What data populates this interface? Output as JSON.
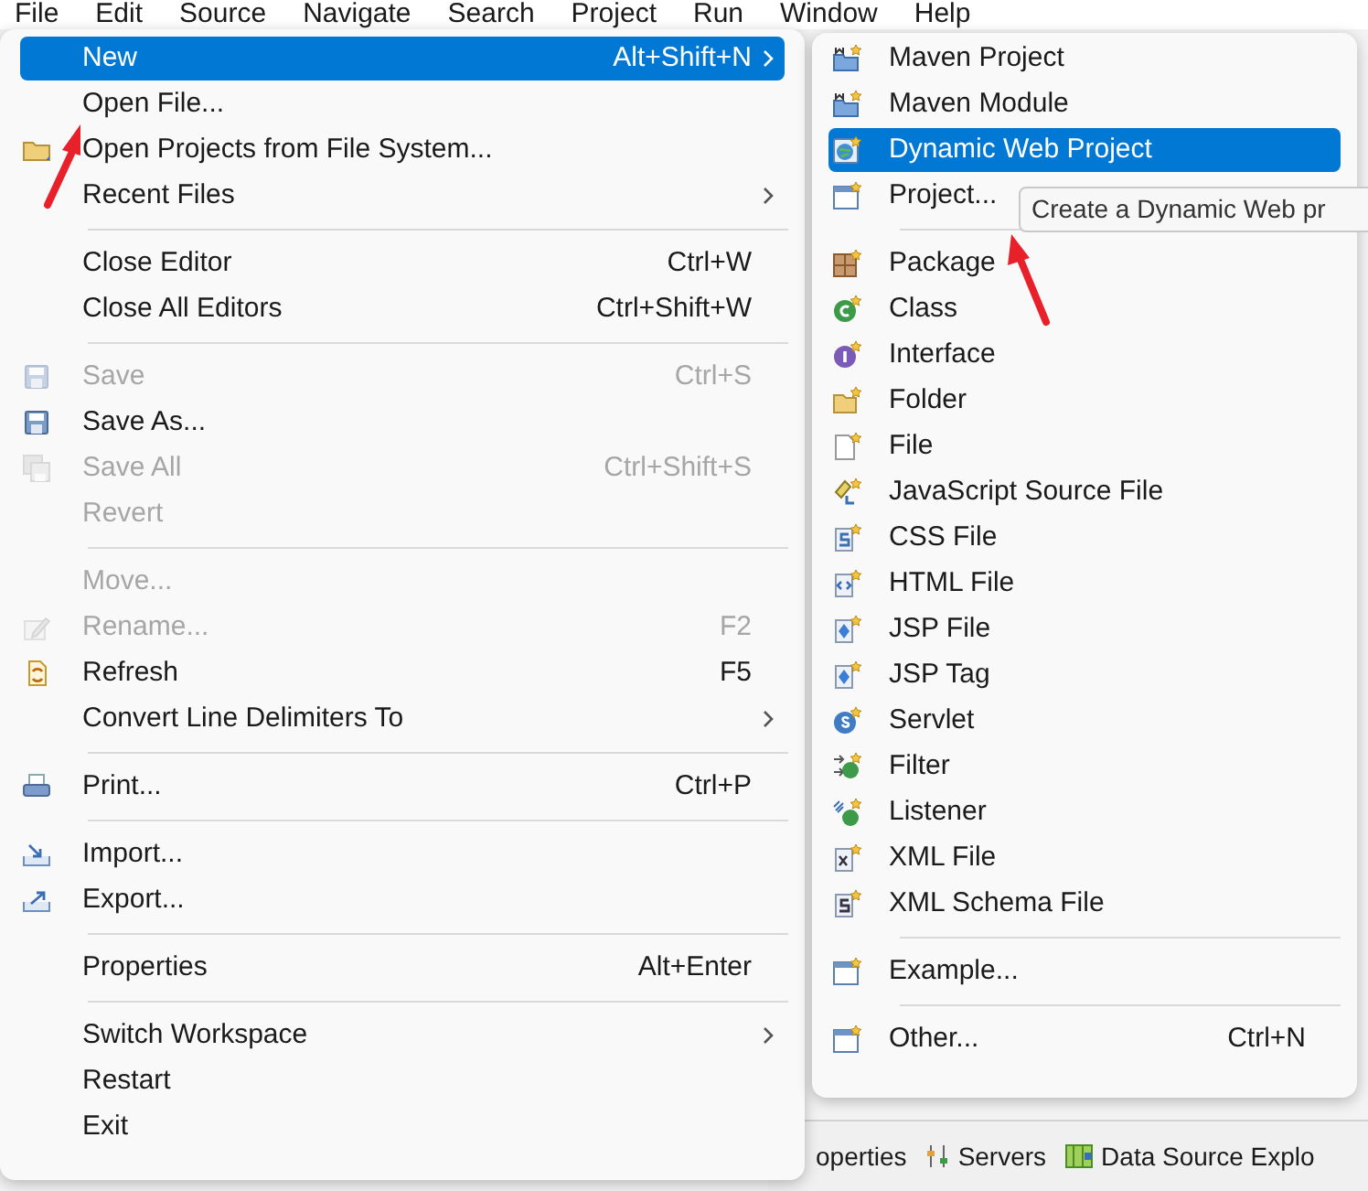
{
  "menubar": [
    "File",
    "Edit",
    "Source",
    "Navigate",
    "Search",
    "Project",
    "Run",
    "Window",
    "Help"
  ],
  "file_menu": {
    "items": [
      {
        "kind": "item",
        "label": "New",
        "shortcut": "Alt+Shift+N",
        "submenu": true,
        "disabled": false,
        "selected": true
      },
      {
        "kind": "item",
        "label": "Open File...",
        "disabled": false,
        "selected": false
      },
      {
        "kind": "item",
        "label": "Open Projects from File System...",
        "disabled": false,
        "selected": false
      },
      {
        "kind": "item",
        "label": "Recent Files",
        "submenu": true,
        "disabled": false,
        "selected": false
      },
      {
        "kind": "separator"
      },
      {
        "kind": "item",
        "label": "Close Editor",
        "shortcut": "Ctrl+W",
        "disabled": false,
        "selected": false
      },
      {
        "kind": "item",
        "label": "Close All Editors",
        "shortcut": "Ctrl+Shift+W",
        "disabled": false,
        "selected": false
      },
      {
        "kind": "separator"
      },
      {
        "kind": "item",
        "label": "Save",
        "shortcut": "Ctrl+S",
        "disabled": true,
        "selected": false
      },
      {
        "kind": "item",
        "label": "Save As...",
        "disabled": false,
        "selected": false
      },
      {
        "kind": "item",
        "label": "Save All",
        "shortcut": "Ctrl+Shift+S",
        "disabled": true,
        "selected": false
      },
      {
        "kind": "item",
        "label": "Revert",
        "disabled": true,
        "selected": false
      },
      {
        "kind": "separator"
      },
      {
        "kind": "item",
        "label": "Move...",
        "disabled": true,
        "selected": false
      },
      {
        "kind": "item",
        "label": "Rename...",
        "shortcut": "F2",
        "disabled": true,
        "selected": false
      },
      {
        "kind": "item",
        "label": "Refresh",
        "shortcut": "F5",
        "disabled": false,
        "selected": false
      },
      {
        "kind": "item",
        "label": "Convert Line Delimiters To",
        "submenu": true,
        "disabled": false,
        "selected": false
      },
      {
        "kind": "separator"
      },
      {
        "kind": "item",
        "label": "Print...",
        "shortcut": "Ctrl+P",
        "disabled": false,
        "selected": false
      },
      {
        "kind": "separator"
      },
      {
        "kind": "item",
        "label": "Import...",
        "disabled": false,
        "selected": false
      },
      {
        "kind": "item",
        "label": "Export...",
        "disabled": false,
        "selected": false
      },
      {
        "kind": "separator"
      },
      {
        "kind": "item",
        "label": "Properties",
        "shortcut": "Alt+Enter",
        "disabled": false,
        "selected": false
      },
      {
        "kind": "separator"
      },
      {
        "kind": "item",
        "label": "Switch Workspace",
        "submenu": true,
        "disabled": false,
        "selected": false
      },
      {
        "kind": "item",
        "label": "Restart",
        "disabled": false,
        "selected": false
      },
      {
        "kind": "item",
        "label": "Exit",
        "disabled": false,
        "selected": false
      }
    ]
  },
  "new_submenu": {
    "items": [
      {
        "kind": "item",
        "label": "Maven Project",
        "selected": false
      },
      {
        "kind": "item",
        "label": "Maven Module",
        "selected": false
      },
      {
        "kind": "item",
        "label": "Dynamic Web Project",
        "selected": true
      },
      {
        "kind": "item",
        "label": "Project...",
        "selected": false
      },
      {
        "kind": "separator"
      },
      {
        "kind": "item",
        "label": "Package",
        "selected": false
      },
      {
        "kind": "item",
        "label": "Class",
        "selected": false
      },
      {
        "kind": "item",
        "label": "Interface",
        "selected": false
      },
      {
        "kind": "item",
        "label": "Folder",
        "selected": false
      },
      {
        "kind": "item",
        "label": "File",
        "selected": false
      },
      {
        "kind": "item",
        "label": "JavaScript Source File",
        "selected": false
      },
      {
        "kind": "item",
        "label": "CSS File",
        "selected": false
      },
      {
        "kind": "item",
        "label": "HTML File",
        "selected": false
      },
      {
        "kind": "item",
        "label": "JSP File",
        "selected": false
      },
      {
        "kind": "item",
        "label": "JSP Tag",
        "selected": false
      },
      {
        "kind": "item",
        "label": "Servlet",
        "selected": false
      },
      {
        "kind": "item",
        "label": "Filter",
        "selected": false
      },
      {
        "kind": "item",
        "label": "Listener",
        "selected": false
      },
      {
        "kind": "item",
        "label": "XML File",
        "selected": false
      },
      {
        "kind": "item",
        "label": "XML Schema File",
        "selected": false
      },
      {
        "kind": "separator"
      },
      {
        "kind": "item",
        "label": "Example...",
        "selected": false
      },
      {
        "kind": "separator"
      },
      {
        "kind": "item",
        "label": "Other...",
        "shortcut": "Ctrl+N",
        "selected": false
      }
    ]
  },
  "tooltip": "Create a Dynamic Web pr",
  "bottom_tabs": [
    "operties",
    "Servers",
    "Data Source Explo"
  ]
}
